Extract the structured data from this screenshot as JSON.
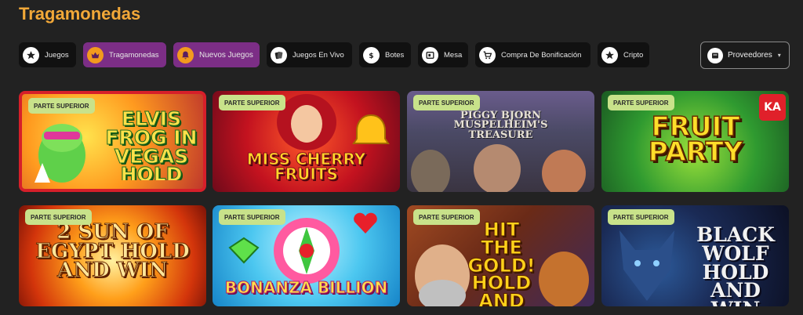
{
  "page_title": "Tragamonedas",
  "categories": [
    {
      "label": "Juegos",
      "icon": "star-icon",
      "active": false
    },
    {
      "label": "Tragamonedas",
      "icon": "crown-icon",
      "active": true
    },
    {
      "label": "Nuevos Juegos",
      "icon": "bell-icon",
      "active": true
    },
    {
      "label": "Juegos En Vivo",
      "icon": "cards-icon",
      "active": false
    },
    {
      "label": "Botes",
      "icon": "dollar-icon",
      "active": false
    },
    {
      "label": "Mesa",
      "icon": "table-icon",
      "active": false
    },
    {
      "label": "Compra De Bonificación",
      "icon": "cart-icon",
      "active": false
    },
    {
      "label": "Cripto",
      "icon": "star-icon",
      "active": false
    }
  ],
  "providers_dropdown": {
    "label": "Proveedores",
    "icon": "provider-icon"
  },
  "badge_label": "PARTE SUPERIOR",
  "games": [
    {
      "title": "ELVIS FROG IN VEGAS HOLD AND WIN"
    },
    {
      "title": "MISS CHERRY FRUITS"
    },
    {
      "title": "PIGGY BJORN MUSPELHEIM'S TREASURE"
    },
    {
      "title": "FRUIT PARTY"
    },
    {
      "title": "2 SUN OF EGYPT HOLD AND WIN"
    },
    {
      "title": "BONANZA BILLION"
    },
    {
      "title": "HIT THE GOLD! HOLD AND WIN"
    },
    {
      "title": "BLACK WOLF HOLD AND WIN"
    }
  ]
}
